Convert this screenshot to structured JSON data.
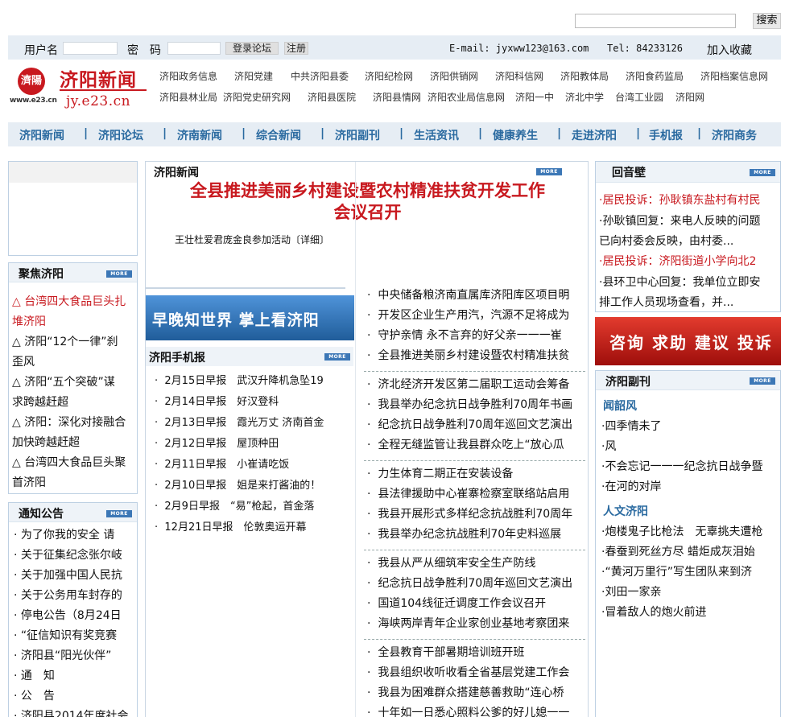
{
  "top": {
    "search_value": "",
    "search_button": "搜索"
  },
  "login": {
    "username_label": "用户名",
    "password_label": "密　码",
    "login_button": "登录论坛",
    "register_button": "注册",
    "email": "E-mail: jyxww123@163.com",
    "tel": "Tel: 84233126",
    "favorite": "加入收藏"
  },
  "logo": {
    "mark": "濟陽",
    "mark_sub": "www.e23.cn",
    "title": "济阳新闻",
    "url": "jy.e23.cn"
  },
  "links": [
    "济阳政务信息",
    "济阳党建",
    "中共济阳县委",
    "济阳纪检网",
    "济阳供销网",
    "济阳科信网",
    "济阳教体局",
    "济阳食药监局",
    "济阳档案信息网",
    "济阳县林业局",
    "济阳党史研究网",
    "济阳县医院",
    "济阳县情网",
    "济阳农业局信息网",
    "济阳一中",
    "济北中学",
    "台湾工业园",
    "济阳网"
  ],
  "nav": [
    "济阳新闻",
    "济阳论坛",
    "济南新闻",
    "综合新闻",
    "济阳副刊",
    "生活资讯",
    "健康养生",
    "走进济阳",
    "手机报",
    "济阳商务"
  ],
  "focus": {
    "title": "聚焦济阳",
    "more": "MORE",
    "items": [
      "△ 台湾四大食品巨头扎",
      "堆济阳",
      "△ 济阳“12个一律”刹",
      "歪风",
      "△ 济阳“五个突破”谋",
      "求跨越赶超",
      "△ 济阳：深化对接融合",
      "加快跨越赶超",
      "△ 台湾四大食品巨头聚",
      "首济阳"
    ]
  },
  "notice": {
    "title": "通知公告",
    "more": "MORE",
    "items": [
      "为了你我的安全 请",
      "关于征集纪念张尔岐",
      "关于加强中国人民抗",
      "关于公务用车封存的",
      "停电公告（8月24日",
      "“征信知识有奖竞赛",
      "济阳县“阳光伙伴”",
      "通　知",
      "公　告",
      "济阳县2014年度社会"
    ]
  },
  "headline": {
    "section": "济阳新闻",
    "more": "MORE",
    "title_line1": "全县推进美丽乡村建设暨农村精准扶贫开发工作",
    "title_line2": "会议召开",
    "summary": "王壮杜爱君庞金良参加活动〔详细〕"
  },
  "banner": {
    "text": "早晚知世界 掌上看济阳"
  },
  "mobile": {
    "title": "济阳手机报",
    "more": "MORE",
    "items": [
      "2月15日早报　武汉升降机急坠19",
      "2月14日早报　好汉登科",
      "2月13日早报　霞光万丈 济南首金",
      "2月12日早报　屋顶种田",
      "2月11日早报　小崔请吃饭",
      "2月10日早报　姐是来打酱油的！",
      "2月9日早报　“易”枪起，首金落",
      "12月21日早报　伦敦奥运开幕"
    ]
  },
  "news": [
    [
      "中央储备粮济南直属库济阳库区项目明",
      "开发区企业生产用汽，汽源不足将成为",
      "守护亲情 永不言弃的好父亲一一一崔",
      "全县推进美丽乡村建设暨农村精准扶贫"
    ],
    [
      "济北经济开发区第二届职工运动会筹备",
      "我县举办纪念抗日战争胜利70周年书画",
      "纪念抗日战争胜利70周年巡回文艺演出",
      "全程无缝监管让我县群众吃上“放心瓜"
    ],
    [
      "力生体育二期正在安装设备",
      "县法律援助中心崔寨检察室联络站启用",
      "我县开展形式多样纪念抗战胜利70周年",
      "我县举办纪念抗战胜利70年史料巡展"
    ],
    [
      "我县从严从细筑牢安全生产防线",
      "纪念抗日战争胜利70周年巡回文艺演出",
      "国道104线征迁调度工作会议召开",
      "海峡两岸青年企业家创业基地考察团来"
    ],
    [
      "全县教育干部暑期培训班开班",
      "我县组织收听收看全省基层党建工作会",
      "我县为困难群众搭建慈善救助“连心桥",
      "十年如一日悉心照料公爹的好儿媳一一"
    ]
  ],
  "echo": {
    "title": "回音壁",
    "more": "MORE",
    "items": [
      {
        "text": "·居民投诉：孙耿镇东盐村有村民",
        "red": true
      },
      {
        "text": "·孙耿镇回复：来电人反映的问题",
        "red": false
      },
      {
        "text": "已向村委会反映，由村委...",
        "red": false
      },
      {
        "text": "·居民投诉：济阳街道小学向北2",
        "red": true
      },
      {
        "text": "·县环卫中心回复：我单位立即安",
        "red": false
      },
      {
        "text": "排工作人员现场查看，并...",
        "red": false
      }
    ]
  },
  "complaint_banner": {
    "text": "咨询 求助 建议 投诉"
  },
  "supplement": {
    "title": "济阳副刊",
    "more": "MORE",
    "sub1": "闻韶风",
    "list1": [
      "·四季情未了",
      "·风",
      "·不会忘记一一一纪念抗日战争暨",
      "·在河的对岸"
    ],
    "sub2": "人文济阳",
    "list2": [
      "·炮楼鬼子比枪法　无辜挑夫遭枪",
      "·春蚕到死丝方尽 蜡炬成灰泪始",
      "·“黄河万里行”写生团队来到济",
      "·刘田一家亲",
      "·冒着敌人的炮火前进"
    ]
  }
}
